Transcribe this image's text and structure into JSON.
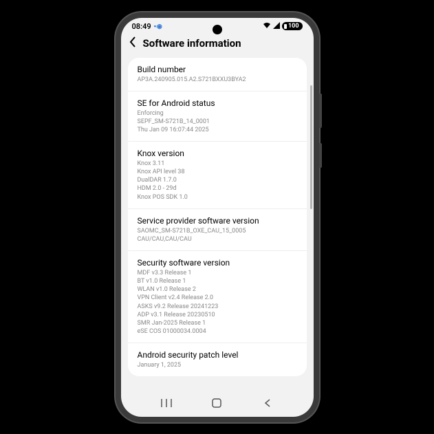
{
  "status_bar": {
    "time": "08:49",
    "battery_level": "100"
  },
  "header": {
    "title": "Software information"
  },
  "sections": [
    {
      "title": "Build number",
      "value": "AP3A.240905.015.A2.S721BXXU3BYA2"
    },
    {
      "title": "SE for Android status",
      "value": "Enforcing\nSEPF_SM-S721B_14_0001\nThu Jan 09 16:07:44 2025"
    },
    {
      "title": "Knox version",
      "value": "Knox 3.11\nKnox API level 38\nDualDAR 1.7.0\nHDM 2.0 - 29d\nKnox POS SDK 1.0"
    },
    {
      "title": "Service provider software version",
      "value": "SAOMC_SM-S721B_OXE_CAU_15_0005\nCAU/CAU,CAU/CAU"
    },
    {
      "title": "Security software version",
      "value": "MDF v3.3 Release 1\nBT v1.0 Release 1\nWLAN v1.0 Release 2\nVPN Client v2.4 Release 2.0\nASKS v9.2  Release 20241223\nADP v3.1 Release 20230510\nSMR Jan-2025 Release 1\neSE COS 01000034.0004"
    },
    {
      "title": "Android security patch level",
      "value": "January 1, 2025"
    }
  ]
}
